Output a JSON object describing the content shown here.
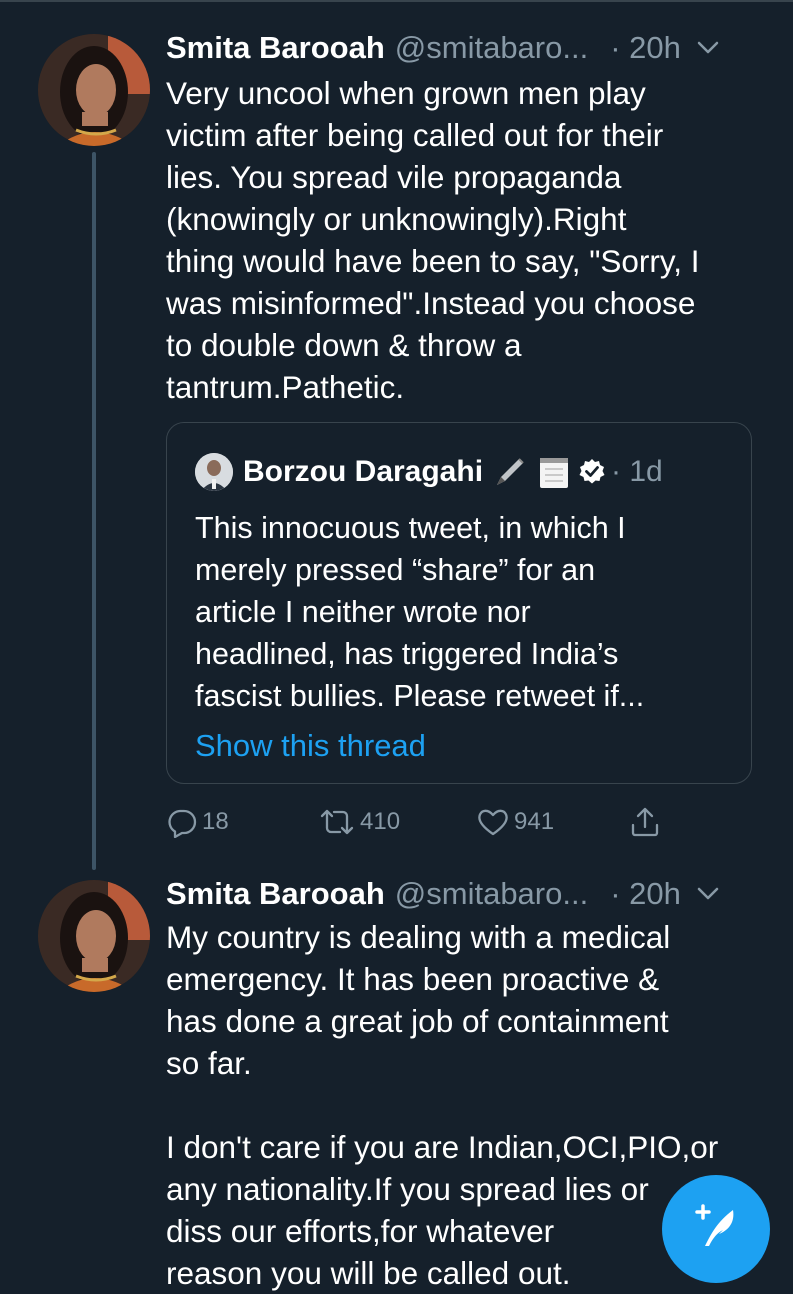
{
  "tweets": [
    {
      "author_name": "Smita Barooah",
      "author_handle": "@smitabaro...",
      "time": "· 20h",
      "text_lines": [
        "Very uncool when grown men play",
        "victim after being called out for their",
        "lies. You spread vile propaganda",
        "(knowingly or unknowingly).Right",
        "thing would have been to say, \"Sorry, I",
        "was misinformed\".Instead you choose",
        "to double down & throw a",
        "tantrum.Pathetic."
      ],
      "quote": {
        "author_name": "Borzou Daragahi",
        "time": "· 1d",
        "text_lines": [
          "This innocuous tweet, in which I",
          "merely pressed “share” for an",
          "article I neither wrote nor",
          "headlined, has triggered India’s",
          "fascist bullies. Please retweet if..."
        ],
        "show_thread": "Show this thread",
        "emoji_icons": [
          "pen-nib-icon",
          "notepad-icon"
        ]
      },
      "actions": {
        "replies": "18",
        "retweets": "410",
        "likes": "941"
      }
    },
    {
      "author_name": "Smita Barooah",
      "author_handle": "@smitabaro...",
      "time": "· 20h",
      "text_lines": [
        "My country is dealing with a medical",
        "emergency. It has been proactive &",
        "has done a great job of containment",
        "so far.",
        "",
        "I don't care if you are Indian,OCI,PIO,or",
        "any nationality.If you spread lies or",
        "diss our efforts,for whatever",
        "reason you will be called out."
      ]
    }
  ],
  "colors": {
    "background": "#15202b",
    "accent": "#1da1f2",
    "secondary_text": "#8899a6",
    "border": "#38444d"
  },
  "compose_icon": "compose-tweet-icon"
}
